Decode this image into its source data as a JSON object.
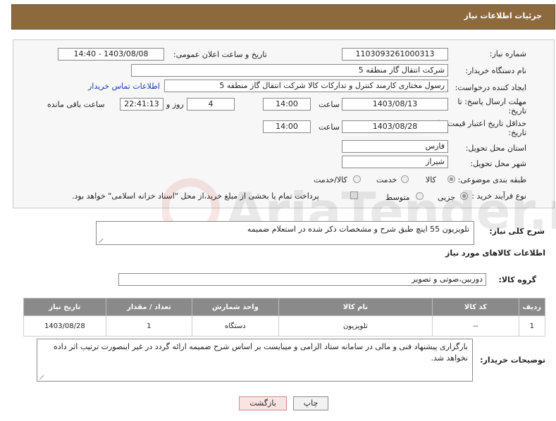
{
  "page": {
    "title": "جزئیات اطلاعات نیاز"
  },
  "fields": {
    "need_number_label": "شماره نیاز:",
    "need_number": "1103093261000313",
    "announce_label": "تاریخ و ساعت اعلان عمومی:",
    "announce_value": "1403/08/08 - 14:40",
    "buyer_label": "نام دستگاه خریدار:",
    "buyer_value": "شرکت انتقال گاز منطقه 5",
    "creator_label": "ایجاد کننده درخواست:",
    "creator_value": "رسول  مختاری کارمند کنترل و تدارکات کالا شرکت انتقال گاز منطقه 5",
    "buyer_contact_link": "اطلاعات تماس خریدار",
    "deadline_label_1": "مهلت ارسال پاسخ: تا",
    "deadline_label_2": "تاریخ:",
    "deadline_date": "1403/08/13",
    "time_label": "ساعت",
    "deadline_time": "14:00",
    "days_value": "4",
    "days_label": "روز و",
    "remaining_time": "22:41:13",
    "remaining_label": "ساعت باقی مانده",
    "price_validity_label_1": "حداقل تاریخ اعتبار قیمت: تا",
    "price_validity_label_2": "تاریخ:",
    "price_validity_date": "1403/08/28",
    "price_validity_time": "14:00",
    "province_label": "استان محل تحویل:",
    "province_value": "فارس",
    "city_label": "شهر محل تحویل:",
    "city_value": "شیراز",
    "category_label": "طبقه بندی موضوعی:",
    "category_options": [
      "کالا",
      "خدمت",
      "کالا/خدمت"
    ],
    "category_selected": "کالا",
    "process_label": "نوع فرآیند خرید :",
    "process_options": [
      "جزیی",
      "متوسط"
    ],
    "process_selected": "جزیی",
    "payment_note": "پرداخت تمام یا بخشی از مبلغ خرید،از محل \"اسناد خزانه اسلامی\" خواهد بود."
  },
  "summary": {
    "label": "شرح کلی نیاز:",
    "value": "تلویزیون 55 اینچ طبق شرح و مشخصات ذکر شده در استعلام ضمیمه"
  },
  "goods": {
    "section_title": "اطلاعات کالاهای مورد نیاز",
    "group_label": "گروه کالا:",
    "group_value": "دوربین،صوتی و تصویر",
    "columns": [
      "ردیف",
      "کد کالا",
      "نام کالا",
      "واحد شمارش",
      "تعداد / مقدار",
      "تاریخ نیاز"
    ],
    "rows": [
      {
        "row": "1",
        "code": "--",
        "name": "تلویزیون",
        "unit": "دستگاه",
        "qty": "1",
        "date": "1403/08/28"
      }
    ]
  },
  "buyer_notes": {
    "label": "توضیحات خریدار:",
    "value": "بارگزاری پیشنهاد فنی و مالی در سامانه ستاد الزامی و میبایست بر اساس شرح ضمیمه ارائه گردد در غیر اینصورت ترتیب اثر داده نخواهد شد."
  },
  "buttons": {
    "print": "چاپ",
    "back": "بازگشت"
  },
  "watermark": {
    "text": "AriaTender.neT"
  },
  "colors": {
    "header": "#8c6a3e",
    "table_header": "#8a8a8a",
    "link": "#1a3fb0",
    "back_button": "#fbe3e3"
  }
}
